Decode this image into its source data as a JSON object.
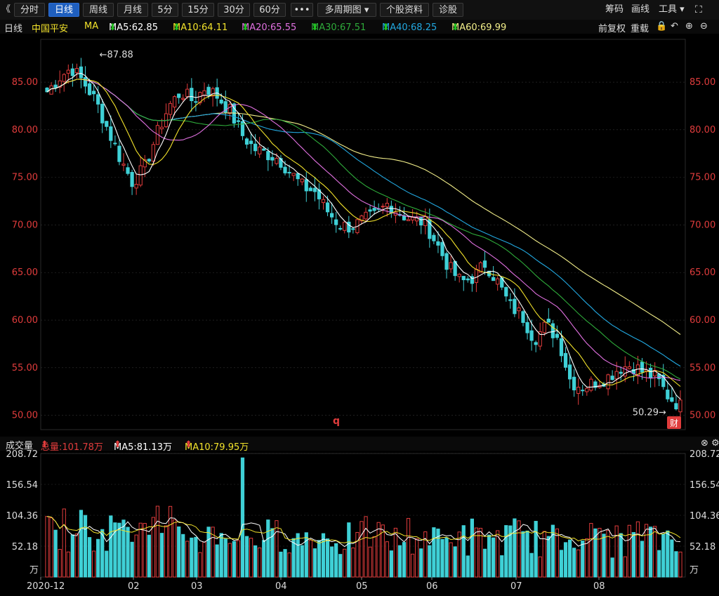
{
  "toolbar": {
    "back_glyph": "《",
    "periods": [
      "分时",
      "日线",
      "周线",
      "月线",
      "5分",
      "15分",
      "30分",
      "60分"
    ],
    "active_period": "日线",
    "more_label": "•••",
    "multi_period_label": "多周期图",
    "stock_info_label": "个股资料",
    "diagnose_label": "诊股",
    "chips_label": "筹码",
    "draw_label": "画线",
    "tools_label": "工具"
  },
  "legend": {
    "period": "日线",
    "stock_name": "中国平安",
    "ma_label": "MA",
    "ma5": "MA5:62.85",
    "ma10": "MA10:64.11",
    "ma20": "MA20:65.55",
    "ma30": "MA30:67.51",
    "ma40": "MA40:68.25",
    "ma60": "MA60:69.99",
    "adjust_label": "前复权",
    "reload_label": "重载"
  },
  "price_panel": {
    "high_annotation": "←87.88",
    "low_annotation": "50.29→",
    "marker_q": "q",
    "fin_badge": "财"
  },
  "volume_header": {
    "title": "成交量",
    "total": "总量:101.78万",
    "ma5": "MA5:81.13万",
    "ma10": "MA10:79.95万"
  },
  "colors": {
    "up": "#e03c3c",
    "down": "#3fd0d6",
    "ma5": "#ffffff",
    "ma10": "#f2e22b",
    "ma20": "#e070e0",
    "ma30": "#2eaa3a",
    "ma40": "#22a8e0",
    "ma60": "#f2ee8a",
    "price_axis": "#e03c3c",
    "grid": "#333333"
  },
  "chart_data": [
    {
      "type": "candlestick",
      "title": "中国平安 日线",
      "y_ticks": [
        "85.00",
        "80.00",
        "75.00",
        "70.00",
        "65.00",
        "60.00",
        "55.00",
        "50.00"
      ],
      "ylim": [
        48.5,
        89.5
      ],
      "x_labels": [
        "2020-12",
        "02",
        "03",
        "04",
        "05",
        "06",
        "07",
        "08"
      ],
      "high": 87.88,
      "low": 50.29,
      "close_series": [
        84.0,
        85.5,
        86.5,
        85.0,
        83.0,
        80.0,
        77.0,
        74.5,
        76.0,
        79.5,
        82.5,
        84.0,
        83.0,
        84.5,
        83.5,
        82.0,
        79.5,
        78.0,
        77.5,
        77.0,
        75.5,
        74.0,
        73.5,
        71.5,
        70.0,
        69.8,
        70.5,
        71.0,
        72.3,
        71.2,
        70.5,
        70.3,
        68.0,
        65.5,
        64.0,
        64.5,
        66.0,
        64.0,
        61.5,
        60.5,
        58.0,
        59.5,
        58.0,
        53.5,
        53.0,
        53.5,
        54.0,
        55.0,
        55.3,
        54.5,
        54.0,
        52.0,
        51.0
      ]
    },
    {
      "type": "bar",
      "title": "成交量",
      "y_ticks": [
        "208.72",
        "156.54",
        "104.36",
        "52.18"
      ],
      "unit": "万",
      "ylim": [
        0,
        208.72
      ]
    }
  ]
}
